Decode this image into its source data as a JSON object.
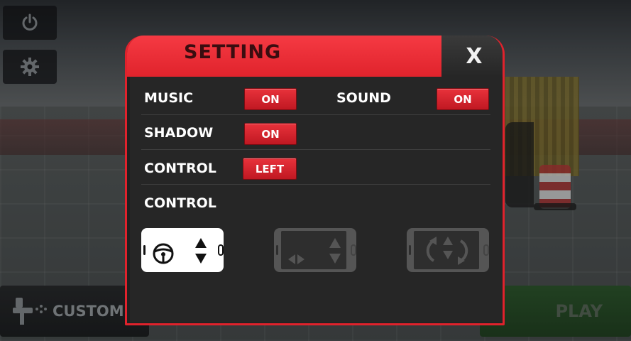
{
  "background": {
    "customize_label": "CUSTOMI",
    "play_label": "PLAY"
  },
  "dialog": {
    "title": "SETTING",
    "close_label": "X",
    "music": {
      "label": "MUSIC",
      "value": "ON"
    },
    "sound": {
      "label": "SOUND",
      "value": "ON"
    },
    "shadow": {
      "label": "SHADOW",
      "value": "ON"
    },
    "control_side": {
      "label": "CONTROL",
      "value": "LEFT"
    },
    "control_type": {
      "label": "CONTROL",
      "options": [
        {
          "icon": "steering-wheel-icon",
          "selected": true
        },
        {
          "icon": "arrow-buttons-icon",
          "selected": false
        },
        {
          "icon": "tilt-icon",
          "selected": false
        }
      ]
    }
  },
  "colors": {
    "accent": "#e0222c",
    "panel": "#262626",
    "text": "#ffffff"
  }
}
